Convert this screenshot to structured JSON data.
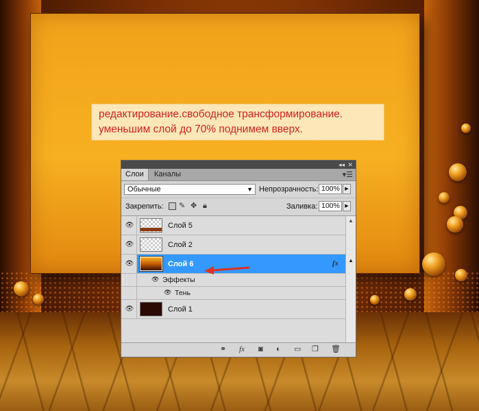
{
  "note": {
    "line1": "редактирование.свободное трансформирование.",
    "line2": "уменьшим слой до 70% поднимем вверх."
  },
  "panel": {
    "collapse_icon": "double-chevron-left-icon",
    "close_icon": "close-icon",
    "tabs": [
      {
        "label": "Слои",
        "active": true
      },
      {
        "label": "Каналы",
        "active": false
      }
    ],
    "menu_icon": "panel-menu-icon",
    "blend_mode": "Обычные",
    "opacity_label": "Непрозрачность:",
    "opacity_value": "100%",
    "lock_label": "Закрепить:",
    "fill_label": "Заливка:",
    "fill_value": "100%",
    "layers": [
      {
        "name": "Слой 5",
        "visible": true,
        "selected": false
      },
      {
        "name": "Слой 2",
        "visible": true,
        "selected": false
      },
      {
        "name": "Слой 6",
        "visible": true,
        "selected": true,
        "fx": "fx"
      },
      {
        "name": "Слой 1",
        "visible": true,
        "selected": false
      }
    ],
    "effects_label": "Эффекты",
    "shadow_label": "Тень",
    "bottom_icons": [
      "link-icon",
      "fx-icon",
      "mask-icon",
      "adjustment-icon",
      "folder-icon",
      "new-layer-icon",
      "trash-icon"
    ],
    "fx_text": "fx"
  },
  "colors": {
    "selection": "#3399ff",
    "note_text": "#d12020",
    "note_bg": "#fde7b8"
  }
}
